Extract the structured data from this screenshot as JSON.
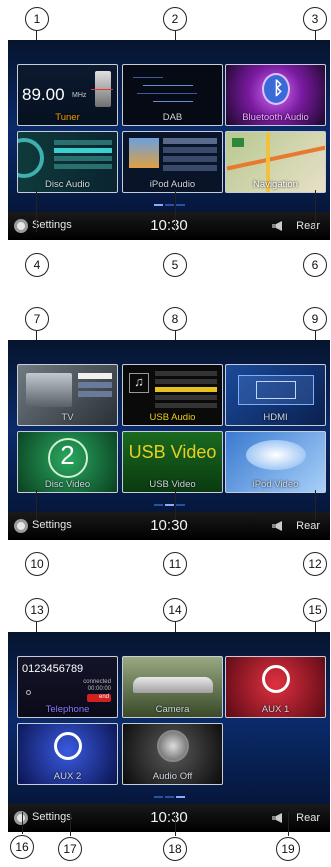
{
  "screens": [
    {
      "tiles": [
        "Tuner",
        "DAB",
        "Bluetooth Audio",
        "Disc Audio",
        "iPod Audio",
        "Navigation"
      ],
      "tuner_freq": "89.00",
      "tuner_unit": "MHz"
    },
    {
      "tiles": [
        "TV",
        "USB Audio",
        "HDMI",
        "Disc Video",
        "USB Video",
        "iPod Video"
      ],
      "disc_video_number": "2",
      "usb_video_big": "USB Video"
    },
    {
      "tiles": [
        "Telephone",
        "Camera",
        "AUX 1",
        "AUX 2",
        "Audio Off"
      ],
      "phone_number": "0123456789",
      "phone_call_status": "connected",
      "phone_call_timer": "00:00:00",
      "phone_end_label": "end"
    }
  ],
  "bottom_bar": {
    "settings_label": "Settings",
    "clock": "10:30",
    "rear_label": "Rear"
  },
  "callouts": [
    "1",
    "2",
    "3",
    "4",
    "5",
    "6",
    "7",
    "8",
    "9",
    "10",
    "11",
    "12",
    "13",
    "14",
    "15",
    "16",
    "17",
    "18",
    "19"
  ],
  "icons": {
    "settings": "settings-gear-icon",
    "rear": "rear-speaker-icon"
  },
  "colors": {
    "tile_border": "#c9ced6",
    "screen_bg": "#000000",
    "accent_blue": "#2c4fa5",
    "tuner_label": "#f0a000",
    "bluetooth_purple": "#b03ad0",
    "disc_video_green": "#1e8a4a",
    "usb_video_text": "#e8d020",
    "aux_red": "#d0243a",
    "aux_blue": "#2a4ac0"
  }
}
